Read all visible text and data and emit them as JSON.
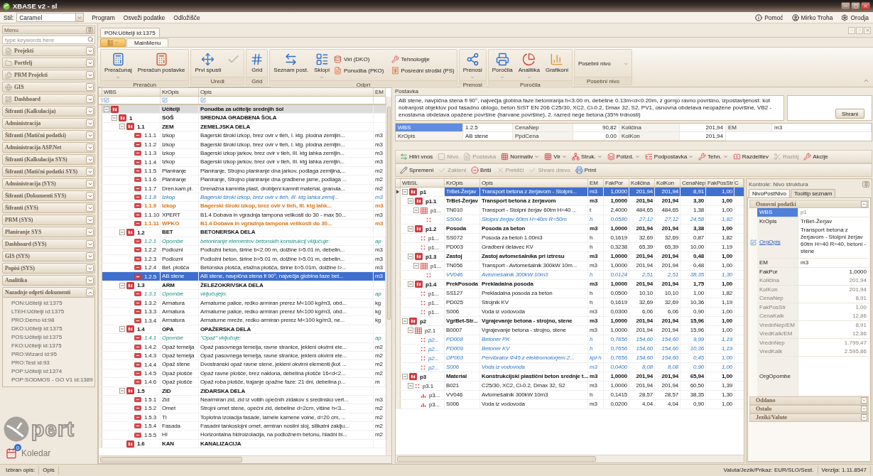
{
  "window": {
    "title": "XBASE v2 - sl"
  },
  "menubar": {
    "style_label": "Stil:",
    "style_value": "Caramel",
    "items": [
      "Program",
      "Osveži podatke",
      "Odložišče"
    ],
    "right_items": [
      {
        "label": "Pomoć"
      },
      {
        "label": "Mirko Troha"
      },
      {
        "label": "Orodja"
      }
    ]
  },
  "sidebar": {
    "title": "Menu",
    "search": {
      "placeholder": "type keywords here"
    },
    "items": [
      {
        "label": "Projekti",
        "kind": "icon",
        "expanded": false
      },
      {
        "label": "Portfelj",
        "kind": "icon",
        "expanded": false
      },
      {
        "label": "PRM Projekti",
        "kind": "icon",
        "expanded": false
      },
      {
        "label": "GIS",
        "kind": "icon",
        "expanded": false
      },
      {
        "label": "Dashboard",
        "kind": "icon",
        "expanded": false
      },
      {
        "label": "Šifranti (Kalkulacija)",
        "kind": "plain",
        "expanded": false
      },
      {
        "label": "Administracija",
        "kind": "plain",
        "expanded": false
      },
      {
        "label": "Šifranti (Matični podatki)",
        "kind": "plain",
        "expanded": false
      },
      {
        "label": "Administracija ASP.Net",
        "kind": "plain",
        "expanded": false
      },
      {
        "label": "Šifranti (Kalkulacija SYS)",
        "kind": "plain",
        "expanded": false
      },
      {
        "label": "Šifranti (Matični podatki SYS)",
        "kind": "plain",
        "expanded": false
      },
      {
        "label": "Administracija (SYS)",
        "kind": "plain",
        "expanded": false
      },
      {
        "label": "Šifranti (Dokumenti SYS)",
        "kind": "plain",
        "expanded": false
      },
      {
        "label": "Šifranti (SYS)",
        "kind": "plain",
        "expanded": false
      },
      {
        "label": "PRM (SYS)",
        "kind": "plain",
        "expanded": false
      },
      {
        "label": "Planiranje SYS",
        "kind": "plain",
        "expanded": false
      },
      {
        "label": "Dashboard (SYS)",
        "kind": "plain",
        "expanded": false
      },
      {
        "label": "GIS (SYS)",
        "kind": "plain",
        "expanded": false
      },
      {
        "label": "Popisi (SYS)",
        "kind": "plain",
        "expanded": false
      },
      {
        "label": "Analitika",
        "kind": "plain",
        "expanded": false
      },
      {
        "label": "Nazadnje odprti dokumenti",
        "kind": "plain",
        "expanded": true,
        "children": [
          "PON:Učitelji id:1375",
          "LTEH:Učitelji id:1375",
          "PRO:Demo id:98",
          "DKO:Učitelji id:1375",
          "POS:Učitelji id:1375",
          "FKO:Učitelji id:1375",
          "PRO:Wizard id:95",
          "PRO:Test id:93",
          "POP:Učitelji id:1374",
          "POP:SODMOS - GO V1 id:1389"
        ]
      }
    ],
    "logo_text": "pert",
    "calendar": {
      "label": "Koledar",
      "badge": "0"
    }
  },
  "document_tabs": [
    {
      "label": "PON:Učitelji id:1375",
      "selected": true
    }
  ],
  "ribbon": {
    "tabs": [
      {
        "label": "MainMenu",
        "selected": true
      }
    ],
    "groups": [
      {
        "label": "Preračun",
        "buttons": [
          {
            "label": "Preračunaj",
            "kind": "large",
            "dropdown": true,
            "disabled": false
          },
          {
            "label": "Preračun postavke",
            "kind": "large",
            "dropdown": false,
            "disabled": false
          }
        ]
      },
      {
        "label": "Uredi",
        "buttons": [
          {
            "label": "Prvi spusti",
            "kind": "large",
            "dropdown": false,
            "disabled": false
          },
          {
            "kind": "large",
            "dropdown": false,
            "disabled": true
          }
        ]
      },
      {
        "label": "Grid",
        "buttons": [
          {
            "label": "Grid",
            "kind": "large",
            "dropdown": false,
            "disabled": false
          }
        ]
      },
      {
        "label": "Odpri",
        "buttons": [
          {
            "label": "Seznam post.",
            "kind": "large",
            "dropdown": false,
            "disabled": false
          },
          {
            "label": "Sklopi",
            "kind": "large",
            "dropdown": true,
            "disabled": false
          },
          {
            "label": "Viri (DKO)",
            "kind": "small",
            "dropdown": false,
            "disabled": false
          },
          {
            "label": "Ponudba (PKO)",
            "kind": "small",
            "dropdown": false,
            "disabled": false
          },
          {
            "label": "Tehnologije",
            "kind": "small",
            "dropdown": false,
            "disabled": false
          },
          {
            "label": "Posredni stroški (PS)",
            "kind": "small",
            "dropdown": false,
            "disabled": false
          }
        ]
      },
      {
        "label": "Prenosi",
        "buttons": [
          {
            "label": "Prenosi",
            "kind": "large",
            "dropdown": true,
            "disabled": false
          }
        ]
      },
      {
        "label": "Poročila",
        "buttons": [
          {
            "label": "Poročila",
            "kind": "large",
            "dropdown": true,
            "disabled": false
          },
          {
            "label": "Analitika",
            "kind": "large",
            "dropdown": true,
            "disabled": false
          },
          {
            "label": "Grafikoni",
            "kind": "large",
            "dropdown": false,
            "disabled": false
          }
        ]
      },
      {
        "label": "Posebni nivo",
        "buttons": [
          {
            "label": "Posebni nivo",
            "kind": "combo",
            "dropdown": true,
            "disabled": false
          }
        ]
      }
    ]
  },
  "tree": {
    "columns": [
      "WBS",
      "KrOpis",
      "Opis",
      "EM"
    ],
    "rows": [
      {
        "kropis": "Učitelji",
        "opis": "Ponudba za učitelje srednjih šol",
        "kind": "root",
        "selected": false,
        "children": [
          {
            "wbs": "1",
            "kropis": "SGŠ",
            "opis": "SREDNJA GRADBENA ŠOLA",
            "kind": "group",
            "selected": false,
            "children": [
              {
                "wbs": "1.1",
                "kropis": "ZEM",
                "opis": "ZEMELJSKA DELA",
                "kind": "group",
                "selected": false,
                "children": [
                  {
                    "wbs": "1.1.1",
                    "kropis": "Izkop",
                    "opis": "Bagerski široki izkop, brez ovir v tleh, I. ktg. plodna zemljin...",
                    "em": "m3",
                    "kind": "item",
                    "selected": false
                  },
                  {
                    "wbs": "1.1.2",
                    "kropis": "Izkop",
                    "opis": "Bagerski široki izkop, brez ovir v tleh, I. ktg. plodna zemljin...",
                    "em": "m3",
                    "kind": "item",
                    "selected": false
                  },
                  {
                    "wbs": "1.1.3",
                    "kropis": "Izkop",
                    "opis": "Bagerski izkop jarkov, brez ovir v tleh, III. ktg lahka zemljin...",
                    "em": "m3",
                    "kind": "item",
                    "selected": false
                  },
                  {
                    "wbs": "1.1.4",
                    "kropis": "Izkop",
                    "opis": "Bagerski izkop jarkov, brez ovir v tleh, III. ktg lahka zemljin...",
                    "em": "m3",
                    "kind": "item",
                    "selected": false
                  },
                  {
                    "wbs": "1.1.5",
                    "kropis": "Planiranje",
                    "opis": "Planiranje, Strojno planiranje dna jarkov, podlaga zemljina,...",
                    "em": "m2",
                    "kind": "item",
                    "selected": false
                  },
                  {
                    "wbs": "1.1.6",
                    "kropis": "Planiranje",
                    "opis": "Planiranje, Strojno planiranje dna gradbene jame, podlaga ...",
                    "em": "m2",
                    "kind": "item",
                    "selected": false
                  },
                  {
                    "wbs": "1.1.7",
                    "kropis": "Dren.kam.pl.",
                    "opis": "Drenažna kamnita plast, drobljeni kamnit material, granula...",
                    "em": "m2",
                    "kind": "item",
                    "selected": false
                  },
                  {
                    "wbs": "1.1.8",
                    "kropis": "Izkop",
                    "opis": "Bagerski široki izkop, brez ovir v tleh, III. ktg lahka zemlj...",
                    "em": "m3",
                    "kind": "inactive",
                    "selected": false
                  },
                  {
                    "wbs": "1.1.9",
                    "kropis": "Izkop",
                    "opis": "Bagerski široki izkop, brez ovir v tleh, III. ktg lahk...",
                    "em": "m3",
                    "kind": "warning",
                    "selected": false
                  },
                  {
                    "wbs": "1.1.10",
                    "kropis": "XPERT",
                    "opis": "B1.4 Dobava in vgradnja tampona velikosti do 30 - max 50...",
                    "em": "m3",
                    "kind": "item",
                    "selected": false
                  },
                  {
                    "wbs": "1.1.11",
                    "kropis": "WPKO",
                    "opis": "B1.4 Dobava in vgradnja tampona velikosti do 30...",
                    "em": "m3",
                    "kind": "warning",
                    "selected": false
                  }
                ]
              },
              {
                "wbs": "1.2",
                "kropis": "BET",
                "opis": "BETONERSKA DELA",
                "kind": "group",
                "selected": false,
                "children": [
                  {
                    "wbs": "1.2.1",
                    "kropis": "Opombe",
                    "opis": "betoniranje elementov betonskih konstrukcij vključuje:",
                    "em": "ap",
                    "kind": "note",
                    "selected": false
                  },
                  {
                    "wbs": "1.2.2",
                    "kropis": "Podlozni",
                    "opis": "Podložni beton, širine b<2.00 m, dolžine l>5.01 m, debelin...",
                    "em": "m3",
                    "kind": "item",
                    "selected": false
                  },
                  {
                    "wbs": "1.2.3",
                    "kropis": "Podlozni",
                    "opis": "Podložni beton, širine b>5.01 m, dolžine l>5.01 m, debelin...",
                    "em": "m3",
                    "kind": "item",
                    "selected": false
                  },
                  {
                    "wbs": "1.2.4",
                    "kropis": "Bet. plošča",
                    "opis": "Betonska plošča, etažna plošča, širine b>5.01m, dolžine l>...",
                    "em": "m3",
                    "kind": "item",
                    "selected": false
                  },
                  {
                    "wbs": "1.2.5",
                    "kropis": "AB stene",
                    "opis": "AB stene, navpična stena fi 90°, največja globina faze bet...",
                    "em": "m3",
                    "kind": "item",
                    "selected": true
                  }
                ]
              },
              {
                "wbs": "1.3",
                "kropis": "ARM",
                "opis": "ŽELEZOKRIVSKA DELA",
                "kind": "group",
                "selected": false,
                "children": [
                  {
                    "wbs": "1.3.1",
                    "kropis": "Opombe",
                    "opis": "vključujejo:",
                    "em": "ap",
                    "kind": "note",
                    "selected": false
                  },
                  {
                    "wbs": "1.3.2",
                    "kropis": "Armatura",
                    "opis": "Armaturne palice, redko armiran prerez M<100 kg/m3, obd...",
                    "em": "kg",
                    "kind": "item",
                    "selected": false
                  },
                  {
                    "wbs": "1.3.3",
                    "kropis": "Armatura",
                    "opis": "Armaturne palice, redko armiran prerez M<100 kg/m3, obd...",
                    "em": "kg",
                    "kind": "item",
                    "selected": false
                  },
                  {
                    "wbs": "1.3.4",
                    "kropis": "Armatura",
                    "opis": "Armaturne mreže, redko armiran prerez M<100 kg/m3, ne...",
                    "em": "kg",
                    "kind": "item",
                    "selected": false
                  }
                ]
              },
              {
                "wbs": "1.4",
                "kropis": "OPA",
                "opis": "OPAŽERSKA DELA",
                "kind": "group",
                "selected": false,
                "children": [
                  {
                    "wbs": "1.4.1",
                    "kropis": "Opombe",
                    "opis": "\"Opaž\" vključuje:",
                    "em": "ap",
                    "kind": "note",
                    "selected": false
                  },
                  {
                    "wbs": "1.4.2",
                    "kropis": "Opaž temelja",
                    "opis": "Opaž pasovnega temelja, ravne stranice, jekleni okvirni ele...",
                    "em": "m2",
                    "kind": "item",
                    "selected": false
                  },
                  {
                    "wbs": "1.4.3",
                    "kropis": "Opaž temelja",
                    "opis": "Opaž pasovnega temelja, ravne stranice, jekleni okvirni ele...",
                    "em": "m2",
                    "kind": "item",
                    "selected": false
                  },
                  {
                    "wbs": "1.4.4",
                    "kropis": "Opaž stene",
                    "opis": "Dvostranski opaž ravne stene, jekleni okvirni elementi (kot ...",
                    "em": "m2",
                    "kind": "item",
                    "selected": false
                  },
                  {
                    "wbs": "1.4.5",
                    "kropis": "Opaž plošče",
                    "opis": "Opaž ravne plošče, brez naklona, debelina plošče 16<d<2...",
                    "em": "m2",
                    "kind": "item",
                    "selected": false
                  },
                  {
                    "wbs": "1.4.6",
                    "kropis": "Opaž plošče",
                    "opis": "Opaž roba plošče, trajanje opažne faze: 21 dni, debelina p...",
                    "em": "m",
                    "kind": "item",
                    "selected": false
                  }
                ]
              },
              {
                "wbs": "1.5",
                "kropis": "ZID",
                "opis": "ZIDARSKA DELA",
                "kind": "group",
                "selected": false,
                "children": [
                  {
                    "wbs": "1.5.1",
                    "kropis": "Zid",
                    "opis": "Nearmiran zid, zid iz votlih opečnih zidakov s sredinsko vert...",
                    "em": "m3",
                    "kind": "item",
                    "selected": false
                  },
                  {
                    "wbs": "1.5.2",
                    "kropis": "Omet",
                    "opis": "Strojni omet stene, opečni zid, debeline d=2cm, višine h<3...",
                    "em": "m2",
                    "kind": "item",
                    "selected": false
                  },
                  {
                    "wbs": "1.5.3",
                    "kropis": "TI",
                    "opis": "Toplotna izolacija fasade, lamele kamene volne, d=20 cm, ...",
                    "em": "m2",
                    "kind": "item",
                    "selected": false
                  },
                  {
                    "wbs": "1.5.4",
                    "kropis": "Fasada",
                    "opis": "Fasadni tankoslojni omet, armiran nosilni sloj, silikatni zaklju...",
                    "em": "m2",
                    "kind": "item",
                    "selected": false
                  },
                  {
                    "wbs": "1.5.5",
                    "kropis": "HI",
                    "opis": "Horizontalna hidroizolacija, na podložnem betonu, hladni bi...",
                    "em": "m2",
                    "kind": "item",
                    "selected": false
                  }
                ]
              },
              {
                "wbs": "1.6",
                "kropis": "KAN",
                "opis": "KANALIZACIJA",
                "kind": "group",
                "selected": false
              }
            ]
          }
        ]
      }
    ]
  },
  "postavka": {
    "label": "Postavka",
    "text": "AB stene, navpična stena fi 90°, največja globina faze betoniranja h<3.00 m, debeline 0.13m<d<0.20m, z gornjo ravno površino, izpostavljenost: kot notranjost objektov pod fasadno oblogo, beton SIST EN 206 C25/30, XC2, Cl-0.2, Dmax 32, S2, PV1, osnovna obdelava neopažene površine, VB2 - enostavna obdelava opažene površine (barvane površine), 2. razred nege betona (35% trdnosti)",
    "save_button": "Shrani"
  },
  "info_fields": [
    {
      "label": "WBS",
      "value": "1.2.5",
      "kind": "text",
      "selected": true
    },
    {
      "label": "CenaNep",
      "value": "90,82",
      "kind": "number",
      "selected": false
    },
    {
      "label": "Količina",
      "value": "201,94",
      "kind": "number",
      "selected": false
    },
    {
      "label": "EM",
      "value": "m3",
      "kind": "text",
      "selected": false
    },
    {
      "label": "KrOpis",
      "value": "AB stene",
      "kind": "text",
      "selected": false
    },
    {
      "label": "PpdCena",
      "value": "0,00",
      "kind": "number",
      "selected": false
    },
    {
      "label": "KolKon",
      "value": "201,94",
      "kind": "number",
      "selected": false
    }
  ],
  "toolbar_primary": [
    {
      "label": "Hitri vnos",
      "dropdown": false,
      "disabled": false
    },
    {
      "label": "Nivo",
      "dropdown": false,
      "disabled": true
    },
    {
      "label": "Postavka",
      "dropdown": false,
      "disabled": true
    },
    {
      "label": "Normativ",
      "dropdown": true,
      "disabled": false
    },
    {
      "label": "Vir",
      "dropdown": true,
      "disabled": false
    },
    {
      "label": "Struk.",
      "dropdown": true,
      "disabled": false
    },
    {
      "label": "Polizd.",
      "dropdown": true,
      "disabled": false
    },
    {
      "label": "Podpostavka",
      "dropdown": true,
      "disabled": false
    },
    {
      "label": "Tehn.",
      "dropdown": true,
      "disabled": false
    },
    {
      "label": "Razdelitev",
      "dropdown": false,
      "disabled": false
    },
    {
      "label": "Razbij",
      "dropdown": false,
      "disabled": true
    },
    {
      "label": "Akcije",
      "dropdown": false,
      "disabled": false
    }
  ],
  "toolbar_secondary": [
    {
      "label": "Spremeni",
      "dropdown": false,
      "disabled": false
    },
    {
      "label": "Zakleni",
      "dropdown": false,
      "disabled": true
    },
    {
      "label": "Briši",
      "dropdown": false,
      "disabled": false
    },
    {
      "label": "Prekliči",
      "dropdown": false,
      "disabled": true
    },
    {
      "label": "Shrani drevo",
      "dropdown": false,
      "disabled": true
    },
    {
      "label": "Print",
      "dropdown": false,
      "disabled": false
    }
  ],
  "structure": {
    "columns": [
      "WBSL",
      "KrOpis",
      "Opis",
      "EM",
      "FakPor",
      "Količina",
      "KolKon",
      "CenaNep",
      "FakPosStr",
      "C"
    ],
    "rows": [
      {
        "cells": [
          "p1",
          "TrBet-Žerjav",
          "Transport betona z žerjavom - Stolpni...",
          "m3",
          "1,0000",
          "201,94",
          "201,94",
          "8,91",
          "1,00"
        ],
        "kind": "group",
        "selected": true,
        "children": [
          {
            "cells": [
              "p1.1",
              "TrBet-Žerjav",
              "Transport betona z žerjavom",
              "m3",
              "1,0000",
              "201,94",
              "201,94",
              "3,30",
              "1,00"
            ],
            "kind": "group",
            "selected": false,
            "children": [
              {
                "cells": [
                  "p1...",
                  "TN010",
                  "Transport - Stolpni žerjav 60tm H=40 ...",
                  "t",
                  "2,4000",
                  "484,65",
                  "484,65",
                  "1,38",
                  "1,00"
                ],
                "kind": "norm",
                "selected": false,
                "children": [
                  {
                    "cells": [
                      "",
                      "S5064",
                      "Stolpni žerjav 60tm H=40m R=50m",
                      "h",
                      "0,0580",
                      "27,12",
                      "27,12",
                      "24,58",
                      "1,82"
                    ],
                    "kind": "derived",
                    "selected": false
                  }
                ]
              }
            ]
          },
          {
            "cells": [
              "p1.2",
              "Posoda",
              "Posoda za beton",
              "m3",
              "1,0000",
              "201,94",
              "201,94",
              "3,38",
              "1,00"
            ],
            "kind": "group",
            "selected": false,
            "children": [
              {
                "cells": [
                  "p1...",
                  "SS072",
                  "Posoda za beton 1.00m3",
                  "h",
                  "0,1619",
                  "32,69",
                  "32,69",
                  "0,87",
                  "1,82"
                ],
                "kind": "resource",
                "selected": false
              },
              {
                "cells": [
                  "p1...",
                  "PD003",
                  "Gradbeni delavec KV",
                  "h",
                  "0,3238",
                  "65,39",
                  "65,39",
                  "10,00",
                  "1,19"
                ],
                "kind": "resource",
                "selected": false
              }
            ]
          },
          {
            "cells": [
              "p1.3",
              "Zastoj",
              "Zastoj avtomešalnika pri iztresu",
              "m3",
              "1,0000",
              "201,94",
              "201,94",
              "0,48",
              "1,00"
            ],
            "kind": "group",
            "selected": false,
            "children": [
              {
                "cells": [
                  "p1...",
                  "TN056",
                  "Transport - Avtomešalnik 300kW 10m...",
                  "m3",
                  "1,0000",
                  "201,94",
                  "201,94",
                  "0,48",
                  "1,00"
                ],
                "kind": "norm",
                "selected": false,
                "children": [
                  {
                    "cells": [
                      "",
                      "VV046",
                      "Avtomešalnik 300kW 10m3",
                      "h",
                      "0,0124",
                      "2,51",
                      "2,51",
                      "38,35",
                      "1,30"
                    ],
                    "kind": "derived",
                    "selected": false
                  }
                ]
              }
            ]
          },
          {
            "cells": [
              "p1.4",
              "PrekPosoda",
              "Prekladalna posoda",
              "m3",
              "1,0000",
              "201,94",
              "201,94",
              "1,75",
              "1,00"
            ],
            "kind": "group",
            "selected": false,
            "children": [
              {
                "cells": [
                  "p1...",
                  "SS127",
                  "Prekladalna posoda za beton",
                  "h",
                  "0,0500",
                  "10,10",
                  "10,10",
                  "1,00",
                  "1,82"
                ],
                "kind": "resource",
                "selected": false
              },
              {
                "cells": [
                  "p1...",
                  "PD025",
                  "Strojnik KV",
                  "h",
                  "0,1619",
                  "32,69",
                  "32,69",
                  "10,36",
                  "1,19"
                ],
                "kind": "resource",
                "selected": false
              },
              {
                "cells": [
                  "p1...",
                  "S006",
                  "Voda iz vodovoda",
                  "m3",
                  "0,0300",
                  "6,06",
                  "6,06",
                  "0,90",
                  "1,00"
                ],
                "kind": "resource",
                "selected": false
              }
            ]
          }
        ]
      },
      {
        "cells": [
          "p2",
          "VgrBet-Str...",
          "Vgrajevanje betona - strojno, stene",
          "m3",
          "1,0000",
          "201,94",
          "201,94",
          "15,96",
          "1,00"
        ],
        "kind": "group",
        "selected": false,
        "children": [
          {
            "cells": [
              "p2.1",
              "B0007",
              "Vgrajevanje betona - strojno, stene",
              "m3",
              "1,0000",
              "201,94",
              "201,94",
              "15,96",
              "1,00"
            ],
            "kind": "norm",
            "selected": false,
            "children": [
              {
                "cells": [
                  "p2...",
                  "PD008",
                  "Betoner PK",
                  "h",
                  "0,7656",
                  "154,60",
                  "154,60",
                  "9,99",
                  "1,19"
                ],
                "kind": "derived",
                "selected": false
              },
              {
                "cells": [
                  "p2...",
                  "PD009",
                  "Betoner KV",
                  "h",
                  "0,7656",
                  "154,60",
                  "154,60",
                  "10,36",
                  "1,19"
                ],
                "kind": "derived",
                "selected": false
              },
              {
                "cells": [
                  "p2...",
                  "OP003",
                  "Pervibrator Φ45 z elektromotorjem 2...",
                  "kpl·h",
                  "0,7656",
                  "154,60",
                  "154,60",
                  "0,45",
                  "1,00"
                ],
                "kind": "derived",
                "selected": false
              },
              {
                "cells": [
                  "p2...",
                  "S006",
                  "Voda iz vodovoda",
                  "m3",
                  "0,0400",
                  "8,08",
                  "8,08",
                  "0,90",
                  "1,00"
                ],
                "kind": "derived",
                "selected": false
              }
            ]
          }
        ]
      },
      {
        "cells": [
          "p3",
          "Material",
          "Konstrukcijski plastični beton srednje t...",
          "m3",
          "1,0000",
          "201,94",
          "201,94",
          "65,94",
          "1,00"
        ],
        "kind": "group",
        "selected": false,
        "children": [
          {
            "cells": [
              "p3.1",
              "B021",
              "C25/30, XC2, Cl-0.2, Dmax 32, S2",
              "m3",
              "1,0000",
              "201,94",
              "201,94",
              "60,50",
              "1,39"
            ],
            "kind": "resource",
            "selected": false,
            "children": [
              {
                "cells": [
                  "p3...",
                  "VV046",
                  "Avtomešalnik 300kW 10m3",
                  "h",
                  "0,1415",
                  "28,57",
                  "28,57",
                  "38,35",
                  "1,30"
                ],
                "kind": "material",
                "selected": false
              },
              {
                "cells": [
                  "p3...",
                  "S006",
                  "Voda iz vodovoda",
                  "m3",
                  "0,0200",
                  "4,04",
                  "4,04",
                  "0,90",
                  "1,00"
                ],
                "kind": "material",
                "selected": false
              }
            ]
          }
        ]
      }
    ]
  },
  "properties": {
    "title": "Kontrole: Nivo struktura",
    "tabs": [
      {
        "label": "NivoPostNivo",
        "selected": true
      },
      {
        "label": "Tooltip seznam",
        "selected": false
      }
    ],
    "sections": [
      {
        "label": "Osnovni podatki",
        "expanded": true,
        "rows": [
          {
            "label": "WBS",
            "value": "p1",
            "kind": "text",
            "selected": true,
            "disabled": true
          },
          {
            "label": "KrOpis",
            "value": "TrBet-Žerjav",
            "kind": "text",
            "selected": false,
            "disabled": false
          },
          {
            "label": "OrgOpis",
            "value": "Transport betona z žerjavom - Stolpni žerjav 60tm H=40 R=40, betoni - stene",
            "kind": "linkmemo",
            "selected": false,
            "disabled": false
          },
          {
            "label": "EM",
            "value": "m3",
            "kind": "text",
            "selected": false,
            "disabled": false
          },
          {
            "label": "FakPor",
            "value": "1,0000",
            "kind": "number",
            "selected": false,
            "disabled": false
          },
          {
            "label": "Količina",
            "value": "201,94",
            "kind": "number",
            "selected": false,
            "disabled": true
          },
          {
            "label": "KolKon",
            "value": "201,94",
            "kind": "number",
            "selected": false,
            "disabled": true
          },
          {
            "label": "CenaNep",
            "value": "8,91",
            "kind": "number",
            "selected": false,
            "disabled": true
          },
          {
            "label": "FakPosStr",
            "value": "1,00",
            "kind": "number",
            "selected": false,
            "disabled": true
          },
          {
            "label": "CenaKalk",
            "value": "12,86",
            "kind": "number",
            "selected": false,
            "disabled": true
          },
          {
            "label": "VrednNep/EM",
            "value": "8,91",
            "kind": "number",
            "selected": false,
            "disabled": true
          },
          {
            "label": "VredKalk/EM",
            "value": "12,86",
            "kind": "number",
            "selected": false,
            "disabled": true
          },
          {
            "label": "VrednNep",
            "value": "1.799,47",
            "kind": "number",
            "selected": false,
            "disabled": true
          },
          {
            "label": "VredKalk",
            "value": "2.595,86",
            "kind": "number",
            "selected": false,
            "disabled": true
          },
          {
            "label": "OrgOpombe",
            "kind": "memo",
            "selected": false,
            "disabled": false
          }
        ]
      },
      {
        "label": "Oddano",
        "expanded": false
      },
      {
        "label": "Ostalo",
        "expanded": false
      },
      {
        "label": "Jeziki/Valute",
        "expanded": false
      }
    ]
  },
  "status_bar": {
    "label": "Izbran opis:",
    "value": "Opis",
    "currency": "Valuta/Jezik/Prikaz: EUR/SLO/Sest.",
    "version": "Verzija: 1.11.8547"
  }
}
